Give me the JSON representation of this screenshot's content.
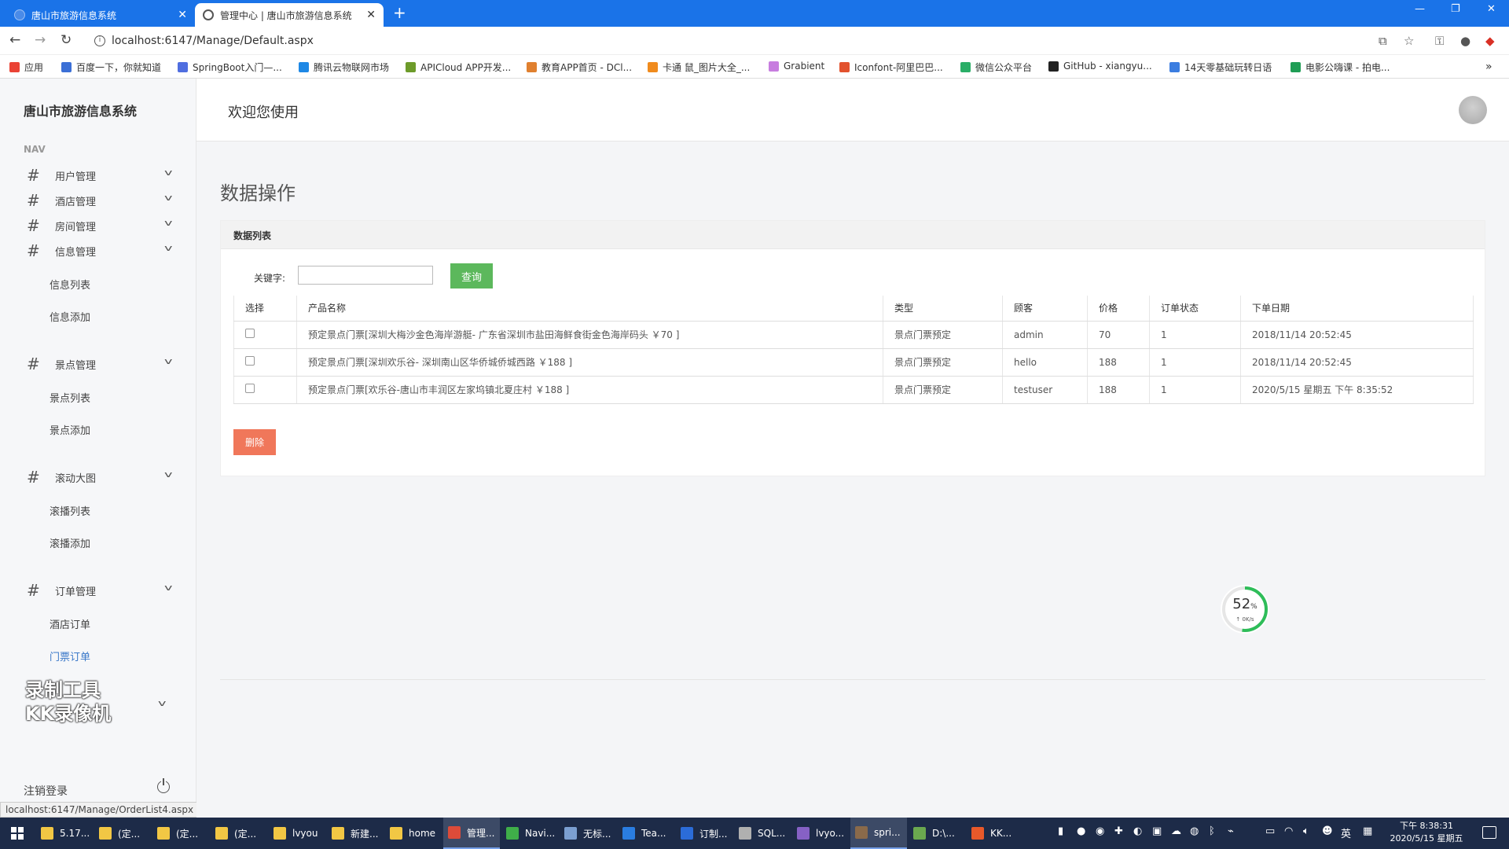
{
  "browser": {
    "tabs": [
      {
        "title": "唐山市旅游信息系统",
        "active": false
      },
      {
        "title": "管理中心 | 唐山市旅游信息系统",
        "active": true
      }
    ],
    "url": "localhost:6147/Manage/Default.aspx",
    "bookmarks": [
      {
        "label": "应用",
        "color": "#ea4335"
      },
      {
        "label": "百度一下，你就知道",
        "color": "#3b6fd6"
      },
      {
        "label": "SpringBoot入门—...",
        "color": "#4f6ee0"
      },
      {
        "label": "腾讯云物联网市场",
        "color": "#1e88e5"
      },
      {
        "label": "APICloud APP开发...",
        "color": "#6d9b2a"
      },
      {
        "label": "教育APP首页 - DCl...",
        "color": "#e0802f"
      },
      {
        "label": "卡通 鼠_图片大全_...",
        "color": "#f08b1d"
      },
      {
        "label": "Grabient",
        "color": "#c77ddf"
      },
      {
        "label": "Iconfont-阿里巴巴...",
        "color": "#e2522e"
      },
      {
        "label": "微信公众平台",
        "color": "#2aae67"
      },
      {
        "label": "GitHub - xiangyu...",
        "color": "#222222"
      },
      {
        "label": "14天零基础玩转日语",
        "color": "#3b7de0"
      },
      {
        "label": "电影公嗨课 - 拍电...",
        "color": "#1f9d55"
      }
    ]
  },
  "sidebar": {
    "brand": "唐山市旅游信息系统",
    "nav_header": "NAV",
    "menus": [
      {
        "label": "用户管理"
      },
      {
        "label": "酒店管理"
      },
      {
        "label": "房间管理"
      },
      {
        "label": "信息管理",
        "subs": [
          "信息列表",
          "信息添加"
        ]
      },
      {
        "label": "景点管理",
        "subs": [
          "景点列表",
          "景点添加"
        ]
      },
      {
        "label": "滚动大图",
        "subs": [
          "滚播列表",
          "滚播添加"
        ]
      },
      {
        "label": "订单管理",
        "subs": [
          "酒店订单",
          "门票订单"
        ]
      }
    ],
    "active_sub": "门票订单",
    "watermark": "录制工具 KK录像机",
    "logout": "注销登录",
    "status_url": "localhost:6147/Manage/OrderList4.aspx"
  },
  "header": {
    "welcome": "欢迎您使用"
  },
  "main": {
    "page_title": "数据操作",
    "panel_title": "数据列表",
    "keyword_label": "关键字:",
    "keyword_value": "",
    "search_button": "查询",
    "delete_button": "删除",
    "table": {
      "columns": [
        "选择",
        "产品名称",
        "类型",
        "顾客",
        "价格",
        "订单状态",
        "下单日期"
      ],
      "rows": [
        [
          "",
          "预定景点门票[深圳大梅沙金色海岸游艇- 广东省深圳市盐田海鲜食街金色海岸码头 ￥70 ]",
          "景点门票预定",
          "admin",
          "70",
          "1",
          "2018/11/14 20:52:45"
        ],
        [
          "",
          "预定景点门票[深圳欢乐谷- 深圳南山区华侨城侨城西路 ￥188 ]",
          "景点门票预定",
          "hello",
          "188",
          "1",
          "2018/11/14 20:52:45"
        ],
        [
          "",
          "预定景点门票[欢乐谷-唐山市丰润区左家坞镇北夏庄村 ￥188 ]",
          "景点门票预定",
          "testuser",
          "188",
          "1",
          "2020/5/15 星期五 下午 8:35:52"
        ]
      ]
    },
    "net_widget": {
      "percent": "52",
      "percent_unit": "%",
      "speed": "↑ 0K/s",
      "fraction": 0.52
    }
  },
  "taskbar": {
    "items": [
      {
        "label": "5.17...",
        "color": "#f2c744",
        "active": false
      },
      {
        "label": "(定...",
        "color": "#f2c744",
        "active": false
      },
      {
        "label": "(定...",
        "color": "#f2c744",
        "active": false
      },
      {
        "label": "(定...",
        "color": "#f2c744",
        "active": false
      },
      {
        "label": "lvyou",
        "color": "#f2c744",
        "active": false
      },
      {
        "label": "新建...",
        "color": "#f2c744",
        "active": false
      },
      {
        "label": "home",
        "color": "#f2c744",
        "active": false
      },
      {
        "label": "管理...",
        "color": "#dd4b39",
        "active": true
      },
      {
        "label": "Navi...",
        "color": "#3fae49",
        "active": false
      },
      {
        "label": "无标...",
        "color": "#7b9fd1",
        "active": false
      },
      {
        "label": "Tea...",
        "color": "#2a7de1",
        "active": false
      },
      {
        "label": "订制...",
        "color": "#2b6cd8",
        "active": false
      },
      {
        "label": "SQL...",
        "color": "#b0b0b0",
        "active": false
      },
      {
        "label": "lvyo...",
        "color": "#8661c5",
        "active": false
      },
      {
        "label": "spri...",
        "color": "#8a6a4a",
        "active": true
      },
      {
        "label": "D:\\...",
        "color": "#6aa84f",
        "active": false
      },
      {
        "label": "KK...",
        "color": "#e8592a",
        "active": false
      }
    ],
    "ime": "英",
    "time": "下午 8:38:31",
    "date": "2020/5/15 星期五"
  }
}
